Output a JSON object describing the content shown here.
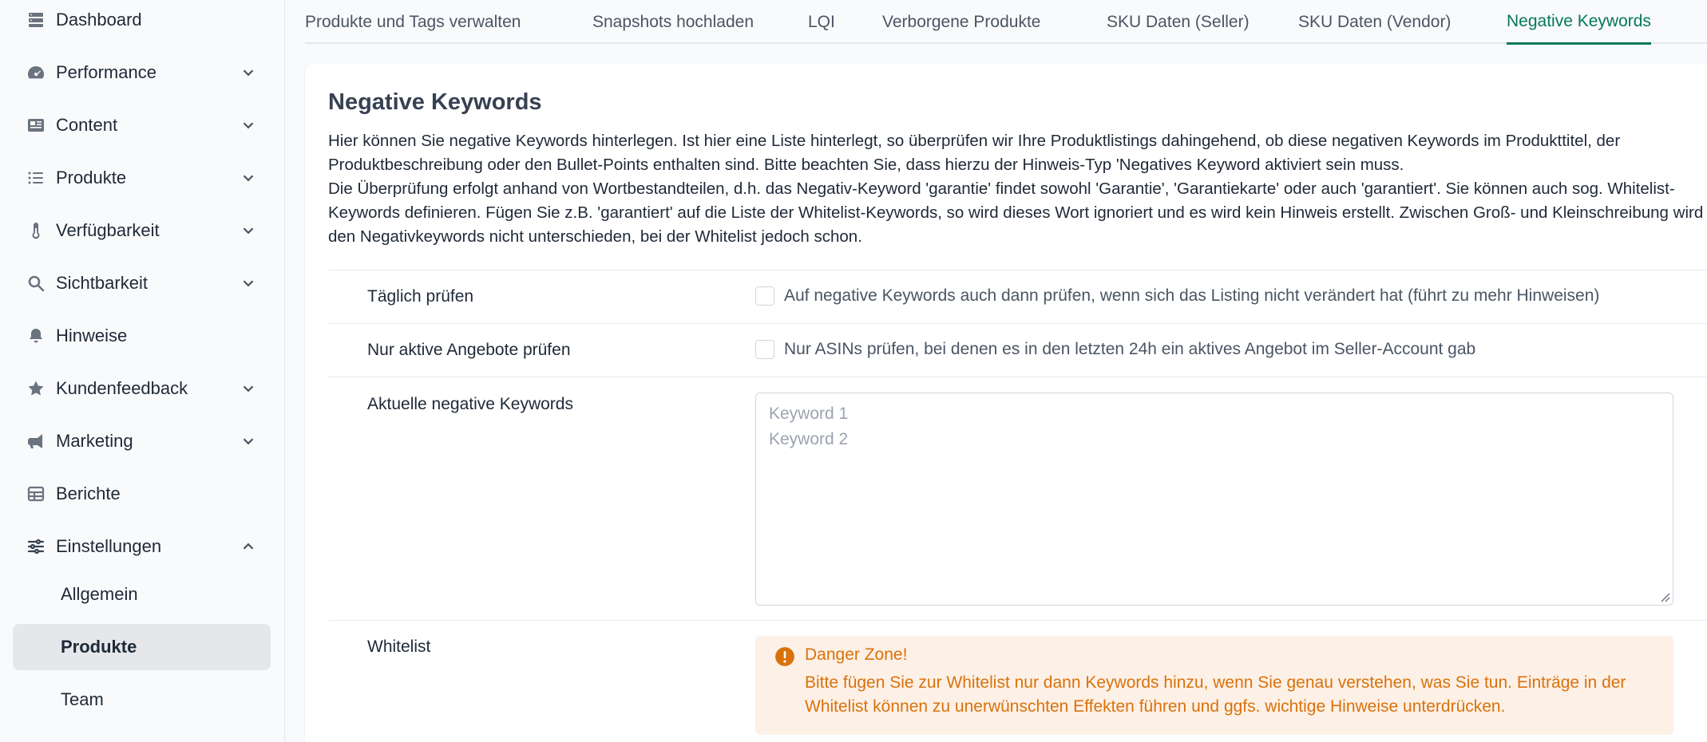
{
  "sidebar": {
    "items": [
      {
        "label": "Dashboard",
        "icon": "server-icon"
      },
      {
        "label": "Performance",
        "icon": "gauge-icon"
      },
      {
        "label": "Content",
        "icon": "newspaper-icon"
      },
      {
        "label": "Produkte",
        "icon": "list-icon"
      },
      {
        "label": "Verfügbarkeit",
        "icon": "thermometer-icon"
      },
      {
        "label": "Sichtbarkeit",
        "icon": "search-icon"
      },
      {
        "label": "Hinweise",
        "icon": "bell-icon"
      },
      {
        "label": "Kundenfeedback",
        "icon": "star-icon"
      },
      {
        "label": "Marketing",
        "icon": "megaphone-icon"
      },
      {
        "label": "Berichte",
        "icon": "table-icon"
      },
      {
        "label": "Einstellungen",
        "icon": "sliders-icon"
      }
    ],
    "subitems": [
      {
        "label": "Allgemein"
      },
      {
        "label": "Produkte"
      },
      {
        "label": "Team"
      }
    ]
  },
  "tabs": [
    {
      "label": "Produkte und Tags verwalten"
    },
    {
      "label": "Snapshots hochladen"
    },
    {
      "label": "LQI"
    },
    {
      "label": "Verborgene Produkte"
    },
    {
      "label": "SKU Daten (Seller)"
    },
    {
      "label": "SKU Daten (Vendor)"
    },
    {
      "label": "Negative Keywords"
    }
  ],
  "card": {
    "title": "Negative Keywords",
    "desc_p1": "Hier können Sie negative Keywords hinterlegen. Ist hier eine Liste hinterlegt, so überprüfen wir Ihre Produktlistings dahingehend, ob diese negativen Keywords im Produkttitel, der Produktbeschreibung oder den Bullet-Points enthalten sind. Bitte beachten Sie, dass hierzu der Hinweis-Typ 'Negatives Keyword aktiviert sein muss.",
    "desc_p2": "Die Überprüfung erfolgt anhand von Wortbestandteilen, d.h. das Negativ-Keyword 'garantie' findet sowohl 'Garantie', 'Garantiekarte' oder auch 'garantiert'. Sie können auch sog. Whitelist-Keywords definieren. Fügen Sie z.B. 'garantiert' auf die Liste der Whitelist-Keywords, so wird dieses Wort ignoriert und es wird kein Hinweis erstellt. Zwischen Groß- und Kleinschreibung wird bei den Negativkeywords nicht unterschieden, bei der Whitelist jedoch schon.",
    "daily_label": "Täglich prüfen",
    "daily_checkbox": "Auf negative Keywords auch dann prüfen, wenn sich das Listing nicht verändert hat (führt zu mehr Hinweisen)",
    "active_label": "Nur aktive Angebote prüfen",
    "active_checkbox": "Nur ASINs prüfen, bei denen es in den letzten 24h ein aktives Angebot im Seller-Account gab",
    "keywords_label": "Aktuelle negative Keywords",
    "keywords_placeholder": "Keyword 1\nKeyword 2",
    "whitelist_label": "Whitelist",
    "alert_title": "Danger Zone!",
    "alert_text": "Bitte fügen Sie zur Whitelist nur dann Keywords hinzu, wenn Sie genau verstehen, was Sie tun. Einträge in der Whitelist können zu unerwünschten Effekten führen und ggfs. wichtige Hinweise unterdrücken."
  },
  "colors": {
    "accent": "#047857",
    "warning": "#d9720b",
    "warning_bg": "#fdf0e6"
  }
}
